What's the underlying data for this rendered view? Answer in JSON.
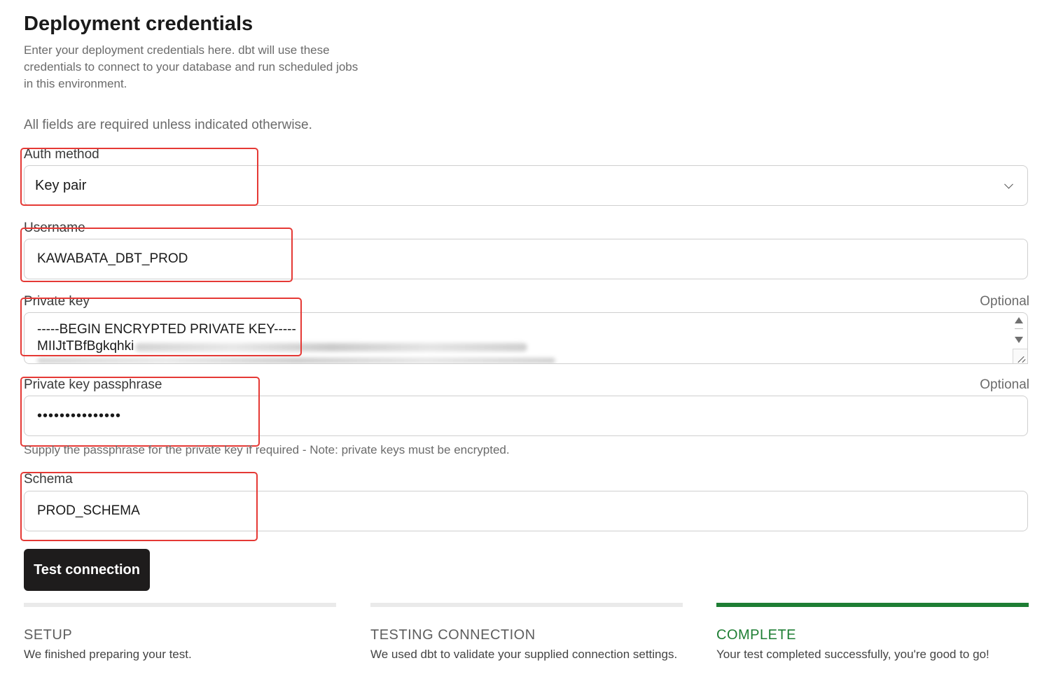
{
  "header": {
    "title": "Deployment credentials",
    "subtitle": "Enter your deployment credentials here. dbt will use these credentials to connect to your database and run scheduled jobs in this environment.",
    "required_note": "All fields are required unless indicated otherwise."
  },
  "form": {
    "auth_method": {
      "label": "Auth method",
      "value": "Key pair"
    },
    "username": {
      "label": "Username",
      "value": "KAWABATA_DBT_PROD"
    },
    "private_key": {
      "label": "Private key",
      "optional": "Optional",
      "line1": "-----BEGIN ENCRYPTED PRIVATE KEY-----",
      "line2": "MIIJtTBfBgkqhki"
    },
    "passphrase": {
      "label": "Private key passphrase",
      "optional": "Optional",
      "value": "•••••••••••••••",
      "helper": "Supply the passphrase for the private key if required - Note: private keys must be encrypted."
    },
    "schema": {
      "label": "Schema",
      "value": "PROD_SCHEMA"
    }
  },
  "actions": {
    "test_connection": "Test connection"
  },
  "steps": [
    {
      "title": "SETUP",
      "description": "We finished preparing your test.",
      "status": "done"
    },
    {
      "title": "TESTING CONNECTION",
      "description": "We used dbt to validate your supplied connection settings.",
      "status": "done"
    },
    {
      "title": "COMPLETE",
      "description": "Your test completed successfully, you're good to go!",
      "status": "complete"
    }
  ],
  "colors": {
    "accent_complete": "#1e7e34",
    "highlight": "#e53935",
    "button_bg": "#1e1c1c"
  }
}
